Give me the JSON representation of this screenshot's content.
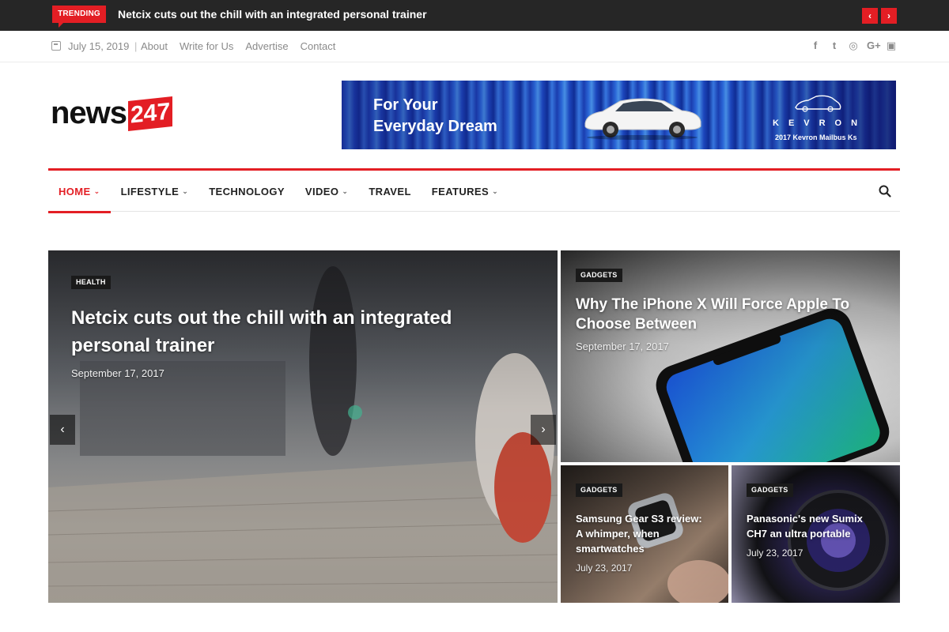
{
  "trending": {
    "label": "TRENDING",
    "headline": "Netcix cuts out the chill with an integrated personal trainer",
    "prev_icon": "‹",
    "next_icon": "›"
  },
  "topbar": {
    "date": "July 15, 2019",
    "separator": "|",
    "links": [
      "About",
      "Write for Us",
      "Advertise",
      "Contact"
    ],
    "socials": [
      {
        "name": "facebook-icon",
        "glyph": "f"
      },
      {
        "name": "twitter-icon",
        "glyph": "t"
      },
      {
        "name": "instagram-icon",
        "glyph": "◎"
      },
      {
        "name": "google-plus-icon",
        "glyph": "G+"
      },
      {
        "name": "youtube-icon",
        "glyph": "▣"
      }
    ]
  },
  "logo": {
    "word": "news",
    "number": "247"
  },
  "banner": {
    "line1": "For Your",
    "line2": "Everyday Dream",
    "brand": "KEVRON",
    "sub": "2017 Kevron Mailbus Ks"
  },
  "nav": {
    "items": [
      {
        "label": "HOME",
        "dropdown": true,
        "active": true
      },
      {
        "label": "LIFESTYLE",
        "dropdown": true
      },
      {
        "label": "TECHNOLOGY",
        "dropdown": false
      },
      {
        "label": "VIDEO",
        "dropdown": true
      },
      {
        "label": "TRAVEL",
        "dropdown": false
      },
      {
        "label": "FEATURES",
        "dropdown": true
      }
    ],
    "chevron": "⌄"
  },
  "featured": {
    "main": {
      "category": "HEALTH",
      "title_line1": "Netcix cuts out the chill with an integrated",
      "title_line2": "personal trainer",
      "date": "September 17, 2017"
    },
    "iphone": {
      "category": "GADGETS",
      "title_line1": "Why The iPhone X Will Force Apple To",
      "title_line2": "Choose Between",
      "date": "September 17, 2017"
    },
    "samsung": {
      "category": "GADGETS",
      "title_line1": "Samsung Gear S3 review:",
      "title_line2": "A whimper, when",
      "title_line3": "smartwatches",
      "date": "July 23, 2017"
    },
    "panasonic": {
      "category": "GADGETS",
      "title_line1": "Panasonic's new Sumix",
      "title_line2": "CH7 an ultra portable",
      "date": "July 23, 2017"
    },
    "prev_icon": "‹",
    "next_icon": "›"
  },
  "colors": {
    "accent": "#e31e24",
    "dark": "#262626"
  }
}
